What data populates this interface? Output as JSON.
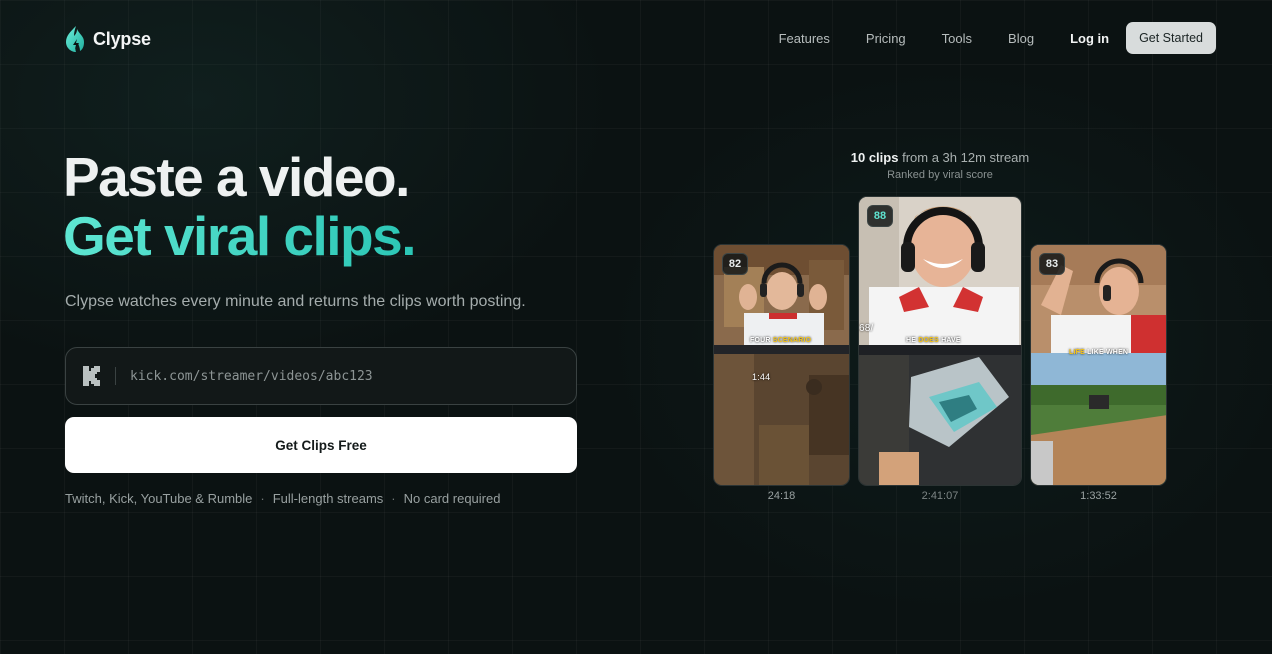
{
  "brand": {
    "name": "Clypse",
    "accent": "#3fd6c2"
  },
  "nav": {
    "links": [
      "Features",
      "Pricing",
      "Tools",
      "Blog"
    ],
    "login": "Log in",
    "cta": "Get Started"
  },
  "hero": {
    "line1": "Paste a video.",
    "line2": "Get viral clips.",
    "subtitle": "Clypse watches every minute and returns the clips worth posting.",
    "input_placeholder": "kick.com/streamer/videos/abc123",
    "input_icon": "kick-logo-icon",
    "button": "Get Clips Free",
    "features": [
      "Twitch, Kick, YouTube & Rumble",
      "Full-length streams",
      "No card required"
    ]
  },
  "clips": {
    "count": "10 clips",
    "from": "from a 3h 12m stream",
    "ranked": "Ranked by viral score",
    "cards": [
      {
        "score": "82",
        "caption_white": "FOUR ",
        "caption_yellow": "SCENARIO",
        "hud": "1:44",
        "duration": "24:18"
      },
      {
        "score": "88",
        "caption_white": "HE ",
        "caption_yellow": "DOES",
        "caption_white2": " HAVE",
        "hud": "68/",
        "duration": "2:41:07"
      },
      {
        "score": "83",
        "caption_yellow": "LIFE",
        "caption_white": " LIKE WHEN",
        "duration": "1:33:52"
      }
    ]
  }
}
